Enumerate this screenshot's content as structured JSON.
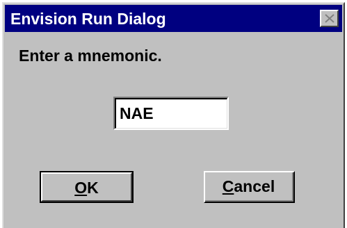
{
  "window": {
    "title": "Envision Run Dialog",
    "close_icon": "close-icon"
  },
  "prompt": {
    "text": "Enter a mnemonic."
  },
  "mnemonic_field": {
    "value": "NAE"
  },
  "buttons": {
    "ok": {
      "mnemonic": "O",
      "rest": "K"
    },
    "cancel": {
      "mnemonic": "C",
      "rest": "ancel"
    }
  },
  "colors": {
    "titlebar": "#000080",
    "face": "#c0c0c0"
  }
}
